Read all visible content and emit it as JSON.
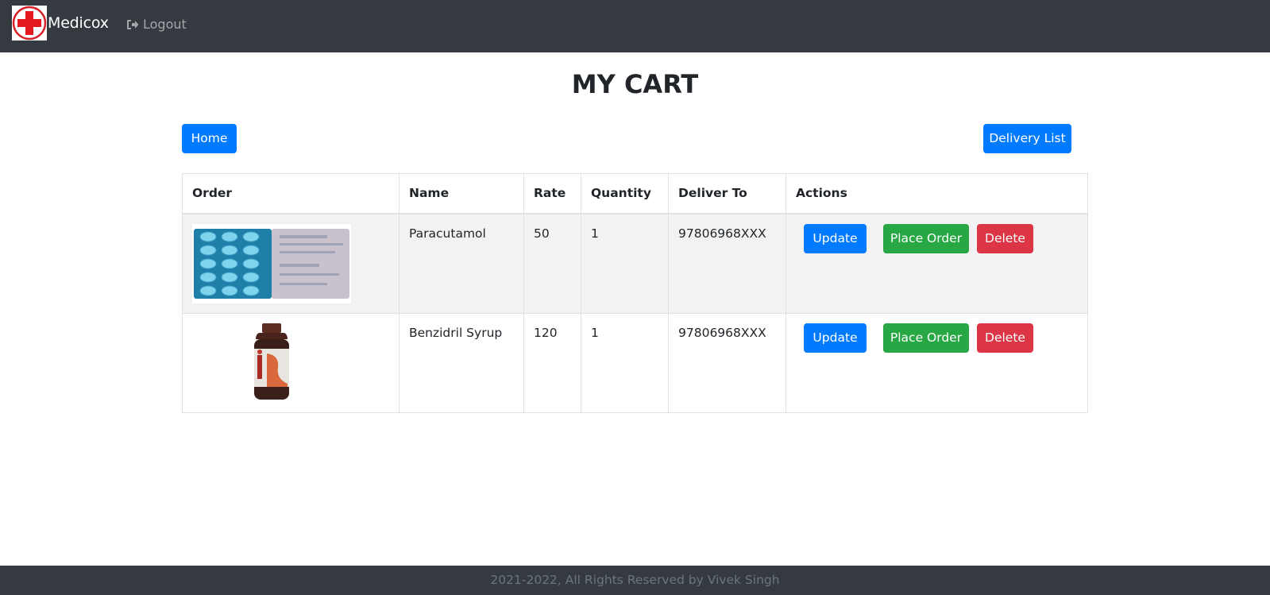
{
  "nav": {
    "brand": "Medicox",
    "logout_label": "Logout"
  },
  "page": {
    "title": "MY CART",
    "home_label": "Home",
    "delivery_list_label": "Delivery List"
  },
  "table": {
    "headers": [
      "Order",
      "Name",
      "Rate",
      "Quantity",
      "Deliver To",
      "Actions"
    ],
    "rows": [
      {
        "name": "Paracutamol",
        "rate": "50",
        "quantity": "1",
        "deliver_to": "97806968XXX"
      },
      {
        "name": "Benzidril Syrup",
        "rate": "120",
        "quantity": "1",
        "deliver_to": "97806968XXX"
      }
    ],
    "actions": {
      "update_label": "Update",
      "place_order_label": "Place Order",
      "delete_label": "Delete"
    }
  },
  "footer": {
    "text": "2021-2022, All Rights Reserved by Vivek Singh"
  },
  "colors": {
    "navbar": "#343a40",
    "primary": "#007bff",
    "success": "#28a745",
    "danger": "#dc3545"
  }
}
